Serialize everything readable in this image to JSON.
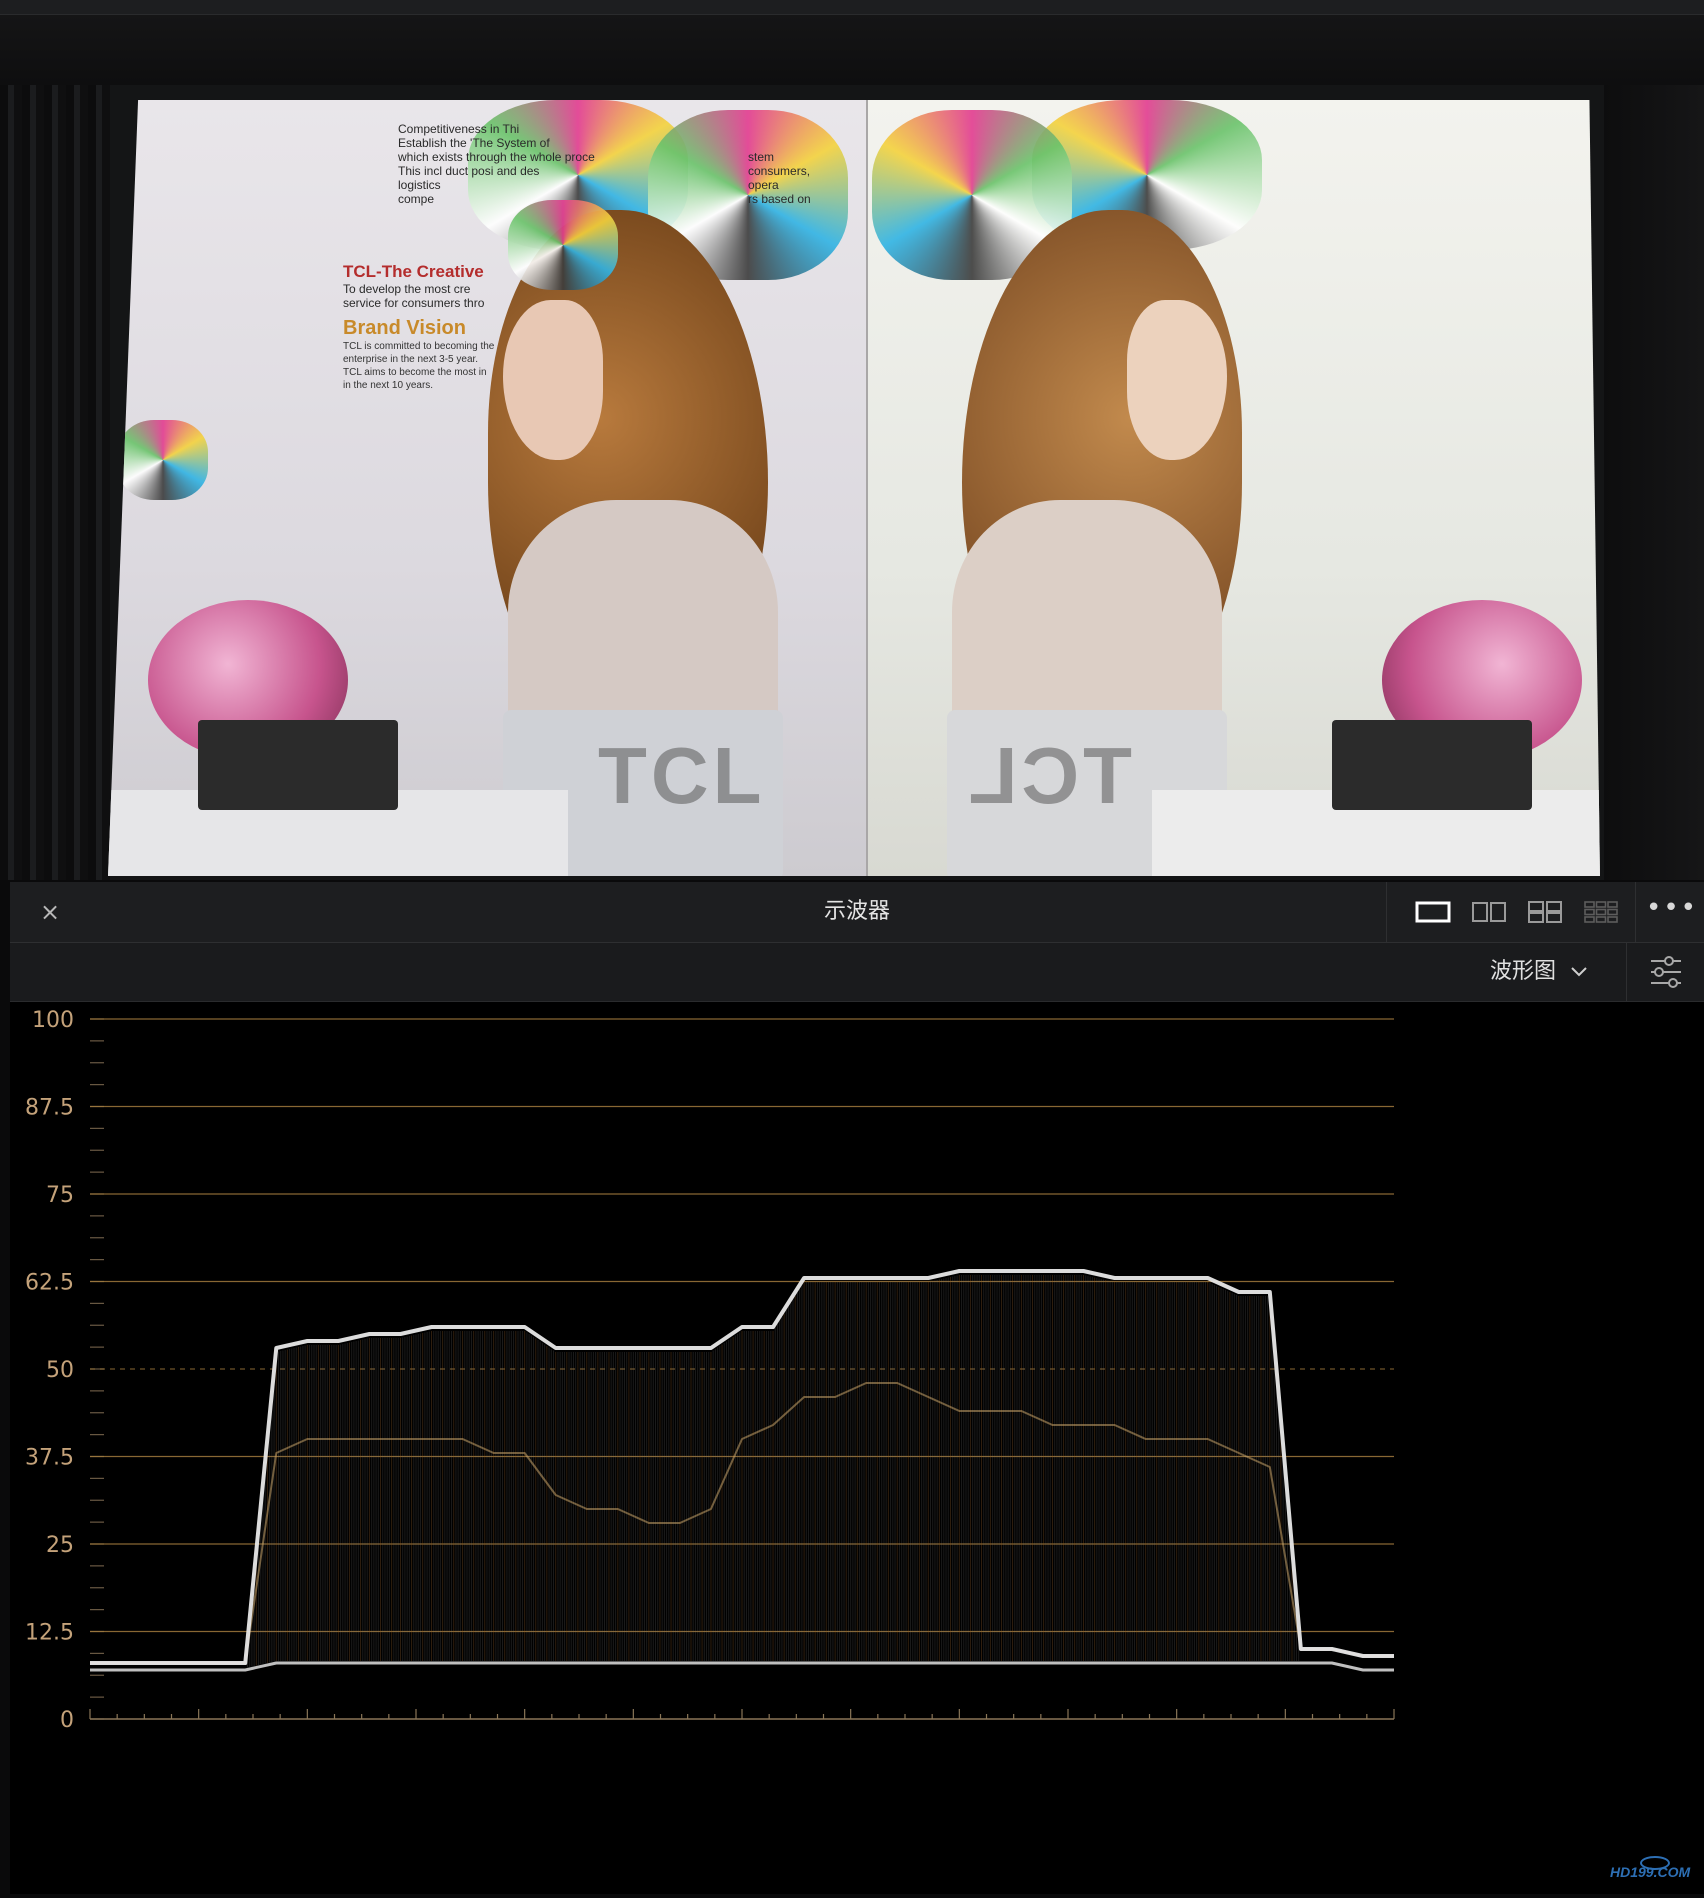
{
  "viewer": {
    "left_page": {
      "headline_1": "TCL-The Creative",
      "sub_1": "To develop the most cre",
      "sub_2": "service for consumers thro",
      "headline_2": "Brand Vision",
      "body_1": "TCL is committed to becoming the",
      "body_2": "enterprise in the next 3-5 year.",
      "body_3": "TCL aims to become the most in",
      "body_4": "in the next 10 years.",
      "top_1": "Competitiveness in Thi",
      "top_2": "Establish the 'The System of",
      "top_3": "which exists through the whole proce",
      "top_4": "This incl     duct posi      and des",
      "top_5": "logistics",
      "top_6": "compe",
      "top_r1": "stem",
      "top_r2": "consumers,",
      "top_r3": "opera",
      "top_r4": "rs based on",
      "brand_mark": "TCL"
    },
    "right_page": {
      "brand_mark": "TCL"
    }
  },
  "scope": {
    "close_icon": "×",
    "title": "示波器",
    "more_label": "•••",
    "mode_label": "波形图",
    "y_ticks": [
      "100",
      "87.5",
      "75",
      "62.5",
      "50",
      "37.5",
      "25",
      "12.5",
      "0"
    ]
  },
  "watermark": "HD199.COM",
  "colors": {
    "graticule": "#a07a3c",
    "label": "#c4a27a",
    "trace": "#e8e8e8",
    "accent_red": "#c0502a"
  },
  "chart_data": {
    "type": "area",
    "ylim": [
      0,
      100
    ],
    "yticks": [
      0,
      12.5,
      25,
      37.5,
      50,
      62.5,
      75,
      87.5,
      100
    ],
    "series": [
      {
        "values_upper": [
          8,
          8,
          8,
          8,
          8,
          8,
          53,
          54,
          54,
          55,
          55,
          56,
          56,
          56,
          56,
          53,
          53,
          53,
          53,
          53,
          53,
          56,
          56,
          63,
          63,
          63,
          63,
          63,
          64,
          64,
          64,
          64,
          64,
          63,
          63,
          63,
          63,
          61,
          61,
          10,
          10,
          9,
          9
        ],
        "values_mid": [
          8,
          8,
          8,
          8,
          8,
          8,
          38,
          40,
          40,
          40,
          40,
          40,
          40,
          38,
          38,
          32,
          30,
          30,
          28,
          28,
          30,
          40,
          42,
          46,
          46,
          48,
          48,
          46,
          44,
          44,
          44,
          42,
          42,
          42,
          40,
          40,
          40,
          38,
          36,
          10,
          10,
          9,
          9
        ],
        "values_lower": [
          7,
          7,
          7,
          7,
          7,
          7,
          8,
          8,
          8,
          8,
          8,
          8,
          8,
          8,
          8,
          8,
          8,
          8,
          8,
          8,
          8,
          8,
          8,
          8,
          8,
          8,
          8,
          8,
          8,
          8,
          8,
          8,
          8,
          8,
          8,
          8,
          8,
          8,
          8,
          8,
          8,
          7,
          7
        ]
      }
    ],
    "grid": true
  }
}
